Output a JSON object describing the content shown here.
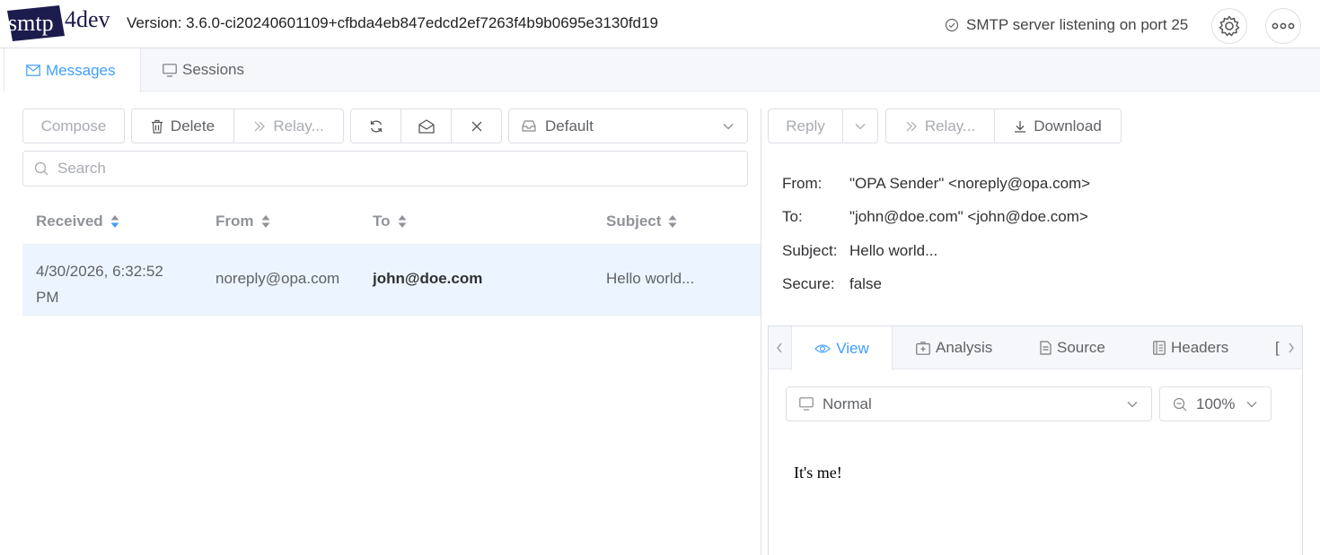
{
  "header": {
    "logo_text": "smtp4dev",
    "version": "Version: 3.6.0-ci20240601109+cfbda4eb847edcd2ef7263f4b9b0695e3130fd19",
    "status": "SMTP server listening on port 25"
  },
  "tabs": {
    "messages": "Messages",
    "sessions": "Sessions"
  },
  "toolbar": {
    "compose": "Compose",
    "delete": "Delete",
    "relay": "Relay...",
    "mailbox_select": "Default"
  },
  "search": {
    "placeholder": "Search"
  },
  "table": {
    "columns": {
      "received": "Received",
      "from": "From",
      "to": "To",
      "subject": "Subject"
    },
    "rows": [
      {
        "received": "4/30/2026, 6:32:52 PM",
        "from": "noreply@opa.com",
        "to": "john@doe.com",
        "subject": "Hello world..."
      }
    ]
  },
  "detail": {
    "reply": "Reply",
    "relay": "Relay...",
    "download": "Download",
    "from_label": "From:",
    "from_value": "\"OPA Sender\" <noreply@opa.com>",
    "to_label": "To:",
    "to_value": "\"john@doe.com\" <john@doe.com>",
    "subject_label": "Subject:",
    "subject_value": "Hello world...",
    "secure_label": "Secure:",
    "secure_value": "false",
    "tabs": {
      "view": "View",
      "analysis": "Analysis",
      "source": "Source",
      "headers": "Headers",
      "partial": "["
    },
    "view_mode": "Normal",
    "zoom": "100%",
    "body": "It's me!"
  },
  "colors": {
    "accent": "#409eff",
    "selected_row": "#ecf5ff",
    "logo_navy": "#1b1b4d"
  }
}
